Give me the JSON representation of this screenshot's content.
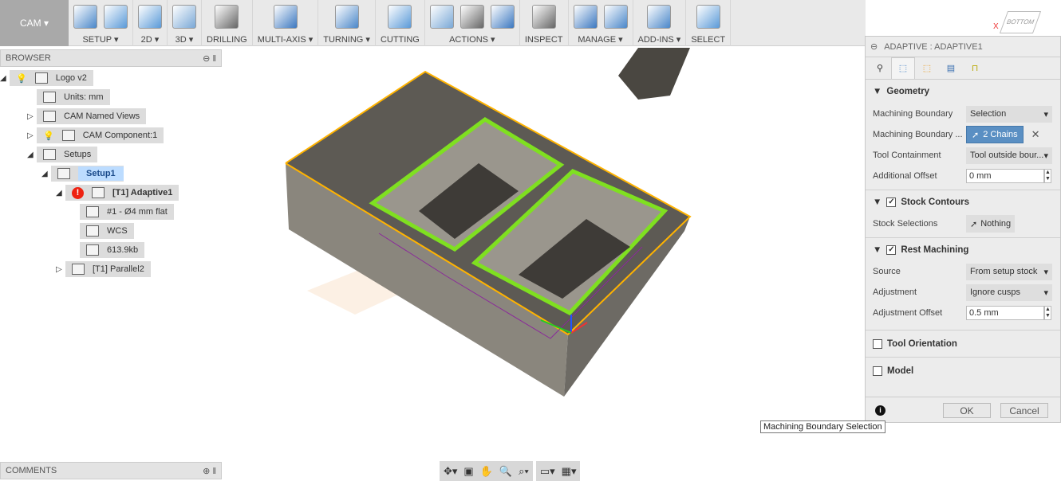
{
  "toolbar": {
    "workspace": "CAM",
    "groups": [
      {
        "label": "SETUP ▾",
        "icons": [
          "setup-icon",
          "setup-sheet-icon"
        ]
      },
      {
        "label": "2D ▾",
        "icons": [
          "2d-pocket-icon"
        ]
      },
      {
        "label": "3D ▾",
        "icons": [
          "3d-adaptive-icon"
        ]
      },
      {
        "label": "DRILLING",
        "icons": [
          "drill-icon"
        ]
      },
      {
        "label": "MULTI-AXIS ▾",
        "icons": [
          "multi-axis-icon"
        ]
      },
      {
        "label": "TURNING ▾",
        "icons": [
          "turning-icon"
        ]
      },
      {
        "label": "CUTTING",
        "icons": [
          "cutting-icon"
        ]
      },
      {
        "label": "ACTIONS ▾",
        "icons": [
          "simulate-icon",
          "post-process-icon",
          "setup-sheet-icon"
        ]
      },
      {
        "label": "INSPECT",
        "icons": [
          "measure-icon"
        ]
      },
      {
        "label": "MANAGE ▾",
        "icons": [
          "tool-library-icon",
          "template-icon"
        ]
      },
      {
        "label": "ADD-INS ▾",
        "icons": [
          "scripts-icon"
        ]
      },
      {
        "label": "SELECT",
        "icons": [
          "select-icon"
        ]
      }
    ]
  },
  "browser": {
    "title": "BROWSER",
    "items": [
      {
        "label": "Logo v2",
        "bold": false
      },
      {
        "label": "Units: mm"
      },
      {
        "label": "CAM Named Views"
      },
      {
        "label": "CAM Component:1"
      },
      {
        "label": "Setups"
      },
      {
        "label": "Setup1"
      },
      {
        "label": "[T1] Adaptive1"
      },
      {
        "label": "#1 - Ø4 mm flat"
      },
      {
        "label": "WCS"
      },
      {
        "label": "613.9kb"
      },
      {
        "label": "[T1] Parallel2"
      }
    ]
  },
  "comments": {
    "title": "COMMENTS"
  },
  "panel": {
    "title": "ADAPTIVE : ADAPTIVE1",
    "geometry": {
      "title": "Geometry",
      "machining_boundary": {
        "label": "Machining Boundary",
        "value": "Selection"
      },
      "boundary_selection": {
        "label": "Machining Boundary ...",
        "value": "2 Chains"
      },
      "tool_containment": {
        "label": "Tool Containment",
        "value": "Tool outside bour..."
      },
      "additional_offset": {
        "label": "Additional Offset",
        "value": "0 mm"
      }
    },
    "stock_contours": {
      "title": "Stock Contours",
      "checked": true,
      "stock_selections": {
        "label": "Stock Selections",
        "value": "Nothing"
      }
    },
    "rest_machining": {
      "title": "Rest Machining",
      "checked": true,
      "source": {
        "label": "Source",
        "value": "From setup stock"
      },
      "adjustment": {
        "label": "Adjustment",
        "value": "Ignore cusps"
      },
      "adjustment_offset": {
        "label": "Adjustment Offset",
        "value": "0.5 mm"
      }
    },
    "tool_orientation": {
      "title": "Tool Orientation",
      "checked": false
    },
    "model": {
      "title": "Model",
      "checked": false
    },
    "ok": "OK",
    "cancel": "Cancel"
  },
  "tooltip": "Machining Boundary Selection",
  "viewcube": {
    "face": "BOTTOM",
    "axis_x": "X"
  },
  "colors": {
    "accent": "#5a8fc3",
    "boundary": "#7fe020",
    "edge": "#ffb300",
    "stock": "#7a766e"
  }
}
